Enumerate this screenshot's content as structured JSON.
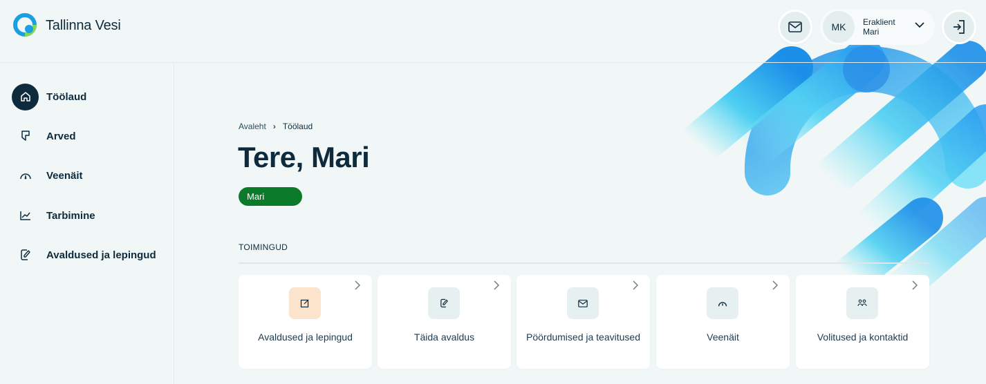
{
  "brand": {
    "name": "Tallinna Vesi"
  },
  "header": {
    "user": {
      "initials": "MK",
      "type": "Eraklient",
      "name": "Mari"
    }
  },
  "sidebar": {
    "items": [
      {
        "label": "Töölaud",
        "icon": "home-icon",
        "active": true
      },
      {
        "label": "Arved",
        "icon": "bookmark-icon",
        "active": false
      },
      {
        "label": "Veenäit",
        "icon": "gauge-icon",
        "active": false
      },
      {
        "label": "Tarbimine",
        "icon": "chart-icon",
        "active": false
      },
      {
        "label": "Avaldused ja lepingud",
        "icon": "document-edit-icon",
        "active": false
      }
    ]
  },
  "main": {
    "breadcrumb": {
      "home": "Avaleht",
      "current": "Töölaud"
    },
    "title": "Tere, Mari",
    "badge": "Mari",
    "section_label": "TOIMINGUD",
    "cards": [
      {
        "label": "Avaldused ja lepingud",
        "icon": "edit-square-icon"
      },
      {
        "label": "Täida avaldus",
        "icon": "document-edit-icon"
      },
      {
        "label": "Pöördumised ja teavitused",
        "icon": "mail-icon"
      },
      {
        "label": "Veenäit",
        "icon": "gauge-icon"
      },
      {
        "label": "Volitused ja kontaktid",
        "icon": "people-icon"
      }
    ]
  },
  "colors": {
    "primary": "#0e2a3d",
    "accent_green": "#0b7a2a",
    "background": "#f1f7f7",
    "highlight_orange": "#fbe3cc"
  }
}
